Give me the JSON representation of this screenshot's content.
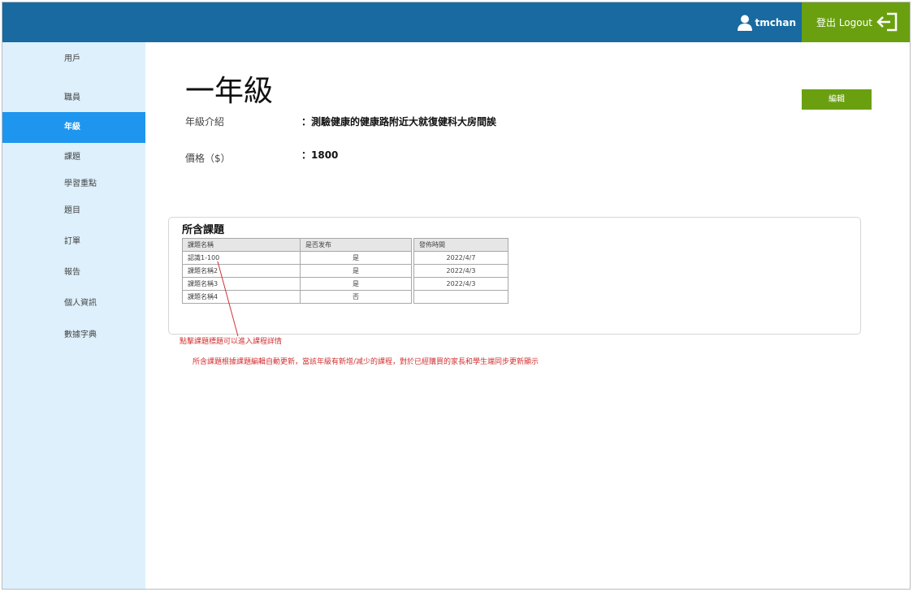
{
  "header": {
    "username": "tmchan",
    "logout_label": "登出 Logout",
    "bar_color": "#186aa1",
    "accent_color": "#6aa010"
  },
  "sidebar": {
    "items": [
      {
        "label": "用戶",
        "icon": "none"
      },
      {
        "label": "職員",
        "icon": "none"
      },
      {
        "label": "年級",
        "icon": "none",
        "active": true
      },
      {
        "label": "課題",
        "icon": "none"
      },
      {
        "label": "學習重點",
        "icon": "none"
      },
      {
        "label": "題目",
        "icon": "none"
      },
      {
        "label": "訂單",
        "icon": "none"
      },
      {
        "label": "報告",
        "icon": "none"
      },
      {
        "label": "個人資訊",
        "icon": "none"
      },
      {
        "label": "數據字典",
        "icon": "none"
      }
    ],
    "active_color": "#1e96f0"
  },
  "main": {
    "title": "一年級",
    "edit_label": "編輯",
    "intro_label": "年級介紹",
    "intro_value": "：測驗健康的健康路附近大就復健科大房間誒",
    "price_label": "價格（$）",
    "price_value": "：1800"
  },
  "lessons": {
    "title": "所含課題",
    "headers": [
      "課題名稱",
      "是否发布",
      "發佈時間"
    ],
    "rows": [
      {
        "name": "認識1-100",
        "published": "是",
        "date": "2022/4/7"
      },
      {
        "name": "課題名稱2",
        "published": "是",
        "date": "2022/4/3"
      },
      {
        "name": "課題名稱3",
        "published": "是",
        "date": "2022/4/3"
      },
      {
        "name": "課題名稱4",
        "published": "否",
        "date": ""
      }
    ]
  },
  "annotations": {
    "note1": "點擊課題標題可以進入課程詳情",
    "note2": "所含課題根據課題編輯自動更新，當該年級有新增/减少的課程，對於已經購買的家長和學生端同步更新顯示",
    "color": "#d23030"
  }
}
